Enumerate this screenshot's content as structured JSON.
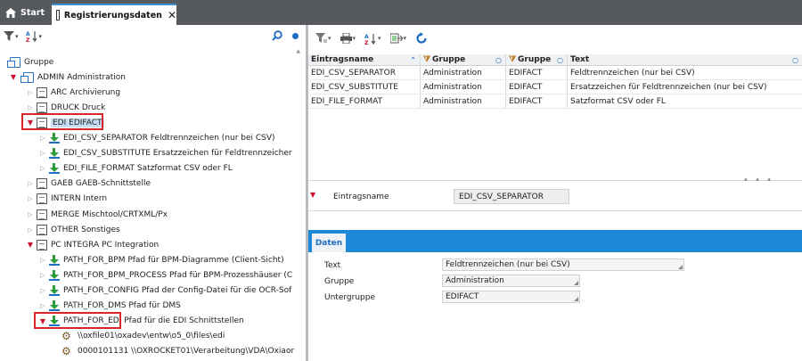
{
  "tabs": {
    "start": "Start",
    "active": "Registrierungsdaten",
    "close_symbol": "✕"
  },
  "left_toolbar": {
    "icons": [
      "filter-icon",
      "sort-az-icon",
      "search-icon",
      "dot-indicator"
    ]
  },
  "tree": [
    {
      "label": "Gruppe",
      "level": 0,
      "icon": "group",
      "expander": "none"
    },
    {
      "label": "ADMIN  Administration",
      "level": 1,
      "icon": "group",
      "expander": "open"
    },
    {
      "label": "ARC  Archivierung",
      "level": 2,
      "icon": "doc",
      "expander": "closed"
    },
    {
      "label": "DRUCK  Druck",
      "level": 2,
      "icon": "doc",
      "expander": "closed"
    },
    {
      "label": "EDI  EDIFACT",
      "level": 2,
      "icon": "doc",
      "expander": "open",
      "selected": true
    },
    {
      "label": "EDI_CSV_SEPARATOR  Feldtrennzeichen (nur bei CSV)",
      "level": 3,
      "icon": "download",
      "expander": "closed"
    },
    {
      "label": "EDI_CSV_SUBSTITUTE  Ersatzzeichen für Feldtrennzeicher",
      "level": 3,
      "icon": "download",
      "expander": "closed"
    },
    {
      "label": "EDI_FILE_FORMAT  Satzformat CSV oder FL",
      "level": 3,
      "icon": "download",
      "expander": "closed"
    },
    {
      "label": "GAEB  GAEB-Schnittstelle",
      "level": 2,
      "icon": "doc",
      "expander": "closed"
    },
    {
      "label": "INTERN  Intern",
      "level": 2,
      "icon": "doc",
      "expander": "closed"
    },
    {
      "label": "MERGE  Mischtool/CRTXML/Px",
      "level": 2,
      "icon": "doc",
      "expander": "closed"
    },
    {
      "label": "OTHER  Sonstiges",
      "level": 2,
      "icon": "doc",
      "expander": "closed"
    },
    {
      "label": "PC INTEGRA  PC Integration",
      "level": 2,
      "icon": "doc",
      "expander": "open"
    },
    {
      "label": "PATH_FOR_BPM  Pfad für BPM-Diagramme (Client-Sicht)",
      "level": 3,
      "icon": "download",
      "expander": "closed"
    },
    {
      "label": "PATH_FOR_BPM_PROCESS  Pfad für BPM-Prozesshäuser (C",
      "level": 3,
      "icon": "download",
      "expander": "closed"
    },
    {
      "label": "PATH_FOR_CONFIG  Pfad der Config-Datei für die OCR-Sof",
      "level": 3,
      "icon": "download",
      "expander": "closed"
    },
    {
      "label": "PATH_FOR_DMS  Pfad für DMS",
      "level": 3,
      "icon": "download",
      "expander": "closed"
    },
    {
      "label": "PATH_FOR_EDI  Pfad für die EDI Schnittstellen",
      "level": 3,
      "icon": "download",
      "expander": "open",
      "highlighted": true
    },
    {
      "label": "\\\\oxfile01\\oxadev\\entw\\o5_0\\files\\edi",
      "level": 4,
      "icon": "gear",
      "expander": "none"
    },
    {
      "label": "0000101131  \\\\OXROCKET01\\Verarbeitung\\VDA\\Oxiaor",
      "level": 4,
      "icon": "gear",
      "expander": "none"
    }
  ],
  "grid": {
    "headers": [
      "Eintragsname",
      "Gruppe",
      "Gruppe",
      "Text"
    ],
    "rows": [
      [
        "EDI_CSV_SEPARATOR",
        "Administration",
        "EDIFACT",
        "Feldtrennzeichen (nur bei CSV)"
      ],
      [
        "EDI_CSV_SUBSTITUTE",
        "Administration",
        "EDIFACT",
        "Ersatzzeichen für Feldtrennzeichen (nur bei CSV)"
      ],
      [
        "EDI_FILE_FORMAT",
        "Administration",
        "EDIFACT",
        "Satzformat CSV oder FL"
      ]
    ]
  },
  "detail": {
    "label": "Eintragsname",
    "value": "EDI_CSV_SEPARATOR"
  },
  "data_tab": {
    "label": "Daten",
    "fields": [
      {
        "label": "Text",
        "value": "Feldtrennzeichen (nur bei CSV)"
      },
      {
        "label": "Gruppe",
        "value": "Administration"
      },
      {
        "label": "Untergruppe",
        "value": "EDIFACT"
      }
    ]
  },
  "colors": {
    "topbar": "#565a5e",
    "accent_blue": "#1e88d8",
    "highlight_red": "#d8262c",
    "selection": "#c5ddf5"
  }
}
